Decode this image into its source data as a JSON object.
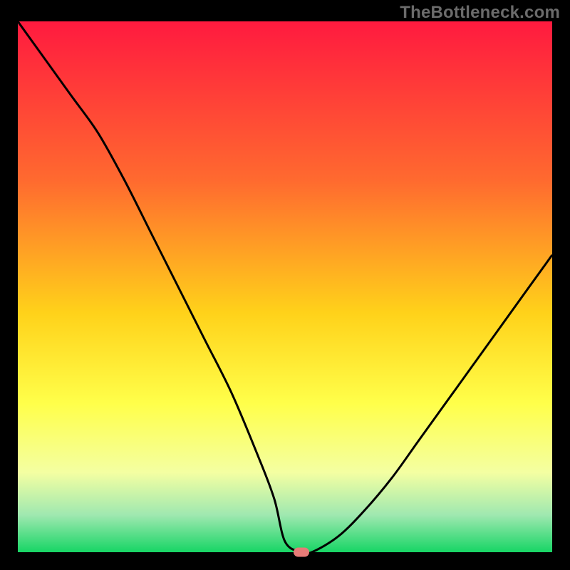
{
  "watermark": {
    "text": "TheBottleneck.com"
  },
  "colors": {
    "gradient_top": "#ff1a3f",
    "gradient_mid1": "#ff6a2f",
    "gradient_mid2": "#ffd21a",
    "gradient_mid3": "#ffff4a",
    "gradient_mid4": "#f4ffa2",
    "gradient_mid5": "#9fe8b0",
    "gradient_bottom": "#17d565",
    "curve": "#000000",
    "marker": "#e77b77",
    "frame": "#000000"
  },
  "chart_data": {
    "type": "line",
    "title": "",
    "xlabel": "",
    "ylabel": "",
    "xlim": [
      0,
      100
    ],
    "ylim": [
      0,
      100
    ],
    "series": [
      {
        "name": "bottleneck-curve",
        "x": [
          0,
          5,
          10,
          15,
          20,
          25,
          30,
          35,
          40,
          45,
          48,
          50,
          53,
          55,
          60,
          65,
          70,
          75,
          80,
          85,
          90,
          95,
          100
        ],
        "y": [
          100,
          93,
          86,
          79,
          70,
          60,
          50,
          40,
          30,
          18,
          10,
          2,
          0,
          0,
          3,
          8,
          14,
          21,
          28,
          35,
          42,
          49,
          56
        ]
      }
    ],
    "annotations": [
      {
        "name": "optimum-marker",
        "x": 53,
        "y": 0
      }
    ],
    "background_gradient": {
      "direction": "vertical",
      "stops": [
        {
          "offset": 0.0,
          "color": "#ff1a3f"
        },
        {
          "offset": 0.3,
          "color": "#ff6a2f"
        },
        {
          "offset": 0.55,
          "color": "#ffd21a"
        },
        {
          "offset": 0.72,
          "color": "#ffff4a"
        },
        {
          "offset": 0.85,
          "color": "#f4ffa2"
        },
        {
          "offset": 0.93,
          "color": "#9fe8b0"
        },
        {
          "offset": 1.0,
          "color": "#17d565"
        }
      ]
    }
  }
}
